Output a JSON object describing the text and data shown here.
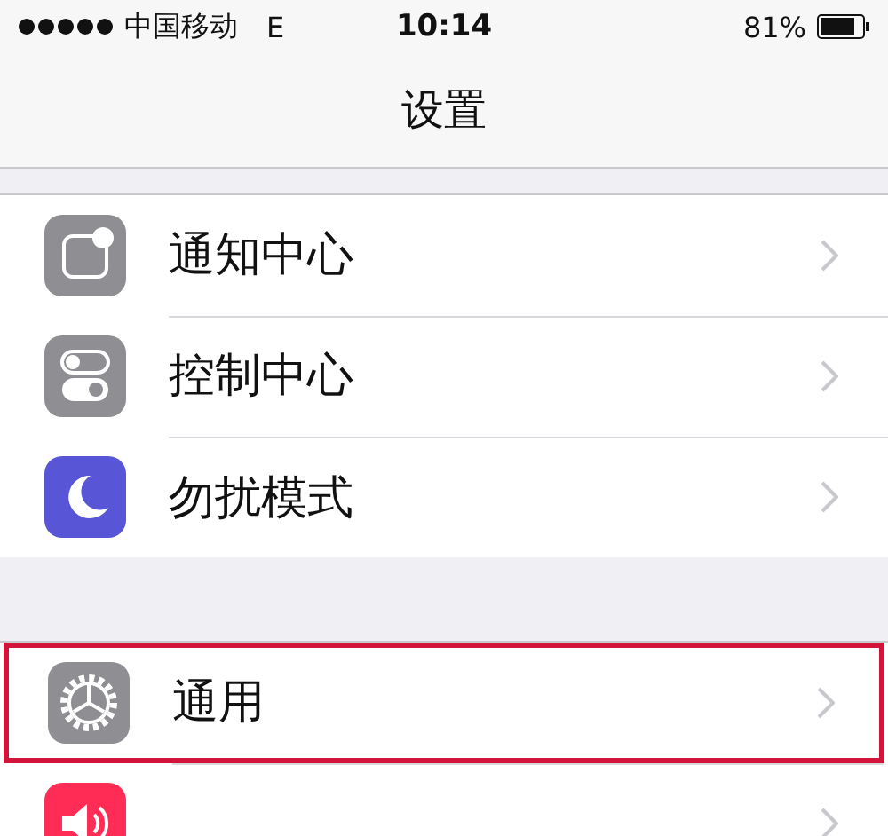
{
  "status_bar": {
    "carrier": "中国移动",
    "network": "E",
    "time": "10:14",
    "battery": "81%"
  },
  "nav": {
    "title": "设置"
  },
  "groups": [
    {
      "rows": [
        {
          "kind": "notifications",
          "label": "通知中心",
          "color": "#8e8e93",
          "highlighted": false
        },
        {
          "kind": "control",
          "label": "控制中心",
          "color": "#8e8e93",
          "highlighted": false
        },
        {
          "kind": "moon",
          "label": "勿扰模式",
          "color": "#5856d6",
          "highlighted": false
        }
      ]
    },
    {
      "rows": [
        {
          "kind": "gear",
          "label": "通用",
          "color": "#8e8e93",
          "highlighted": true
        },
        {
          "kind": "sound",
          "color": "#ff2d55",
          "highlighted": false
        }
      ]
    }
  ]
}
